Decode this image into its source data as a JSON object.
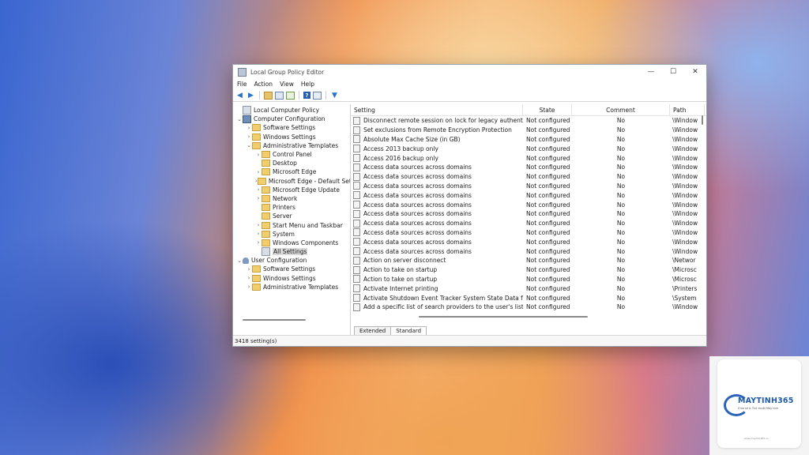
{
  "window": {
    "title": "Local Group Policy Editor",
    "controls": {
      "minimize": "—",
      "maximize": "☐",
      "close": "✕"
    }
  },
  "menu": [
    "File",
    "Action",
    "View",
    "Help"
  ],
  "toolbar_icons": [
    "back-arrow-icon",
    "forward-arrow-icon",
    "folder-up-icon",
    "show-hide-tree-icon",
    "export-list-icon",
    "help-icon",
    "properties-icon",
    "filter-icon"
  ],
  "tree": [
    {
      "label": "Local Computer Policy",
      "level": 0,
      "expander": "",
      "icon": "policy"
    },
    {
      "label": "Computer Configuration",
      "level": 1,
      "expander": "⌄",
      "icon": "computer"
    },
    {
      "label": "Software Settings",
      "level": 2,
      "expander": "›",
      "icon": "folder"
    },
    {
      "label": "Windows Settings",
      "level": 2,
      "expander": "›",
      "icon": "folder"
    },
    {
      "label": "Administrative Templates",
      "level": 2,
      "expander": "⌄",
      "icon": "folder"
    },
    {
      "label": "Control Panel",
      "level": 3,
      "expander": "›",
      "icon": "folder"
    },
    {
      "label": "Desktop",
      "level": 3,
      "expander": "",
      "icon": "folder"
    },
    {
      "label": "Microsoft Edge",
      "level": 3,
      "expander": "›",
      "icon": "folder"
    },
    {
      "label": "Microsoft Edge - Default Setti",
      "level": 3,
      "expander": "›",
      "icon": "folder"
    },
    {
      "label": "Microsoft Edge Update",
      "level": 3,
      "expander": "›",
      "icon": "folder"
    },
    {
      "label": "Network",
      "level": 3,
      "expander": "›",
      "icon": "folder"
    },
    {
      "label": "Printers",
      "level": 3,
      "expander": "",
      "icon": "folder"
    },
    {
      "label": "Server",
      "level": 3,
      "expander": "",
      "icon": "folder"
    },
    {
      "label": "Start Menu and Taskbar",
      "level": 3,
      "expander": "›",
      "icon": "folder"
    },
    {
      "label": "System",
      "level": 3,
      "expander": "›",
      "icon": "folder"
    },
    {
      "label": "Windows Components",
      "level": 3,
      "expander": "›",
      "icon": "folder"
    },
    {
      "label": "All Settings",
      "level": 3,
      "expander": "",
      "icon": "policy",
      "selected": true
    },
    {
      "label": "User Configuration",
      "level": 1,
      "expander": "⌄",
      "icon": "user"
    },
    {
      "label": "Software Settings",
      "level": 2,
      "expander": "›",
      "icon": "folder"
    },
    {
      "label": "Windows Settings",
      "level": 2,
      "expander": "›",
      "icon": "folder"
    },
    {
      "label": "Administrative Templates",
      "level": 2,
      "expander": "›",
      "icon": "folder"
    }
  ],
  "list": {
    "sort_indicator": "^",
    "columns": [
      "Setting",
      "State",
      "Comment",
      "Path"
    ],
    "rows": [
      [
        "Disconnect remote session on lock for legacy authentication",
        "Not configured",
        "No",
        "\\Window"
      ],
      [
        "Set exclusions from Remote Encryption Protection",
        "Not configured",
        "No",
        "\\Window"
      ],
      [
        "Absolute Max Cache Size (in GB)",
        "Not configured",
        "No",
        "\\Window"
      ],
      [
        "Access 2013 backup only",
        "Not configured",
        "No",
        "\\Window"
      ],
      [
        "Access 2016 backup only",
        "Not configured",
        "No",
        "\\Window"
      ],
      [
        "Access data sources across domains",
        "Not configured",
        "No",
        "\\Window"
      ],
      [
        "Access data sources across domains",
        "Not configured",
        "No",
        "\\Window"
      ],
      [
        "Access data sources across domains",
        "Not configured",
        "No",
        "\\Window"
      ],
      [
        "Access data sources across domains",
        "Not configured",
        "No",
        "\\Window"
      ],
      [
        "Access data sources across domains",
        "Not configured",
        "No",
        "\\Window"
      ],
      [
        "Access data sources across domains",
        "Not configured",
        "No",
        "\\Window"
      ],
      [
        "Access data sources across domains",
        "Not configured",
        "No",
        "\\Window"
      ],
      [
        "Access data sources across domains",
        "Not configured",
        "No",
        "\\Window"
      ],
      [
        "Access data sources across domains",
        "Not configured",
        "No",
        "\\Window"
      ],
      [
        "Access data sources across domains",
        "Not configured",
        "No",
        "\\Window"
      ],
      [
        "Action on server disconnect",
        "Not configured",
        "No",
        "\\Networ"
      ],
      [
        "Action to take on startup",
        "Not configured",
        "No",
        "\\Microsc"
      ],
      [
        "Action to take on startup",
        "Not configured",
        "No",
        "\\Microsc"
      ],
      [
        "Activate Internet printing",
        "Not configured",
        "No",
        "\\Printers"
      ],
      [
        "Activate Shutdown Event Tracker System State Data feature",
        "Not configured",
        "No",
        "\\System"
      ],
      [
        "Add a specific list of search providers to the user's list of sea...",
        "Not configured",
        "No",
        "\\Window"
      ]
    ]
  },
  "tabs": [
    "Extended",
    "Standard"
  ],
  "active_tab": "Standard",
  "status": "3418 setting(s)",
  "brand": {
    "name": "MAYTINH365",
    "tagline": "Chia sẻ & Thủ thuật Máy tính",
    "url": "www.maytinh365.vn"
  }
}
